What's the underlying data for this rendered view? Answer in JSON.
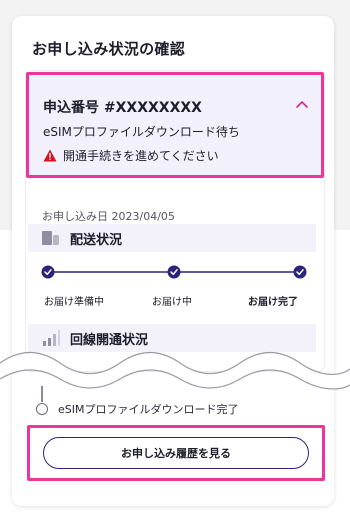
{
  "card": {
    "title": "お申し込み状況の確認"
  },
  "application": {
    "number": "申込番号 #XXXXXXXX",
    "status": "eSIMプロファイルダウンロード待ち",
    "warning": "開通手続きを進めてください",
    "date": "お申し込み日 2023/04/05"
  },
  "delivery": {
    "title": "配送状況",
    "steps": [
      "お届け準備中",
      "お届け中",
      "お届け完了"
    ],
    "completed_steps": 3
  },
  "activation": {
    "title": "回線開通状況",
    "last_step": "eSIMプロファイルダウンロード完了"
  },
  "history_button": {
    "label": "お申し込み履歴を見る"
  },
  "colors": {
    "accent": "#2b2478",
    "highlight": "#f0359a",
    "warning": "#d6101e",
    "panel": "#f2f0fb"
  },
  "icons": [
    "chevron-up-icon",
    "warning-icon",
    "truck-icon",
    "signal-icon",
    "step-check-icon"
  ]
}
